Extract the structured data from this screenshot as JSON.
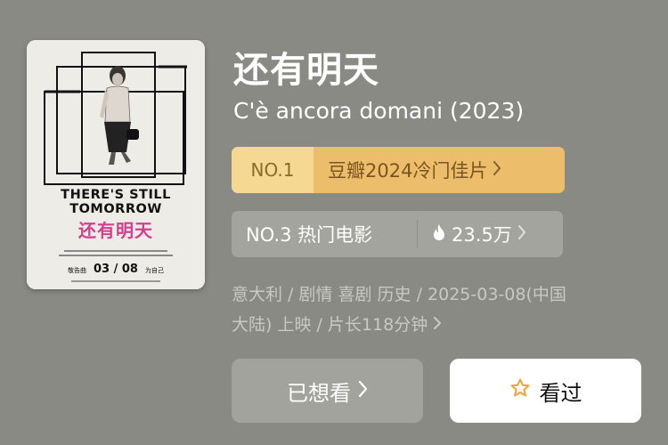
{
  "poster": {
    "title_en_line1": "THERE'S STILL",
    "title_en_line2": "TOMORROW",
    "title_zh": "还有明天",
    "pre_release_label": "敬告曲",
    "release_date": "03 / 08",
    "post_release_label": "为自己"
  },
  "movie": {
    "title_zh": "还有明天",
    "title_original": "C'è ancora domani (2023)",
    "meta_line1": "意大利 / 剧情 喜剧 历史 / 2025-03-08(中国",
    "meta_line2": "大陆) 上映 / 片长118分钟"
  },
  "rankings": {
    "top_rank": "NO.1",
    "top_list": "豆瓣2024冷门佳片",
    "hot_rank_text": "NO.3 热门电影",
    "hot_count": "23.5万"
  },
  "actions": {
    "wanted_label": "已想看",
    "watched_label": "看过"
  },
  "colors": {
    "background": "#8a8a84",
    "gold_light": "#f5d892",
    "gold_dark": "#ecbd6a",
    "star_orange": "#f2a23a"
  },
  "icons": {
    "fire": "fire-icon",
    "star": "star-outline-icon",
    "chevron": "chevron-right-icon"
  }
}
